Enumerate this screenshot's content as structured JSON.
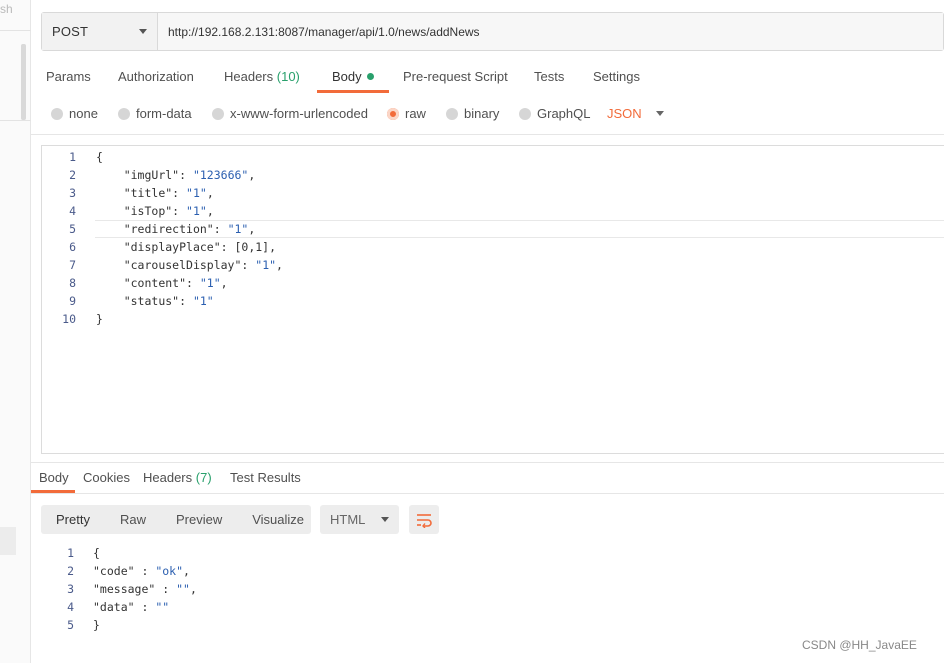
{
  "sidebar": {
    "cut_text": "sh"
  },
  "request": {
    "method": "POST",
    "url": "http://192.168.2.131:8087/manager/api/1.0/news/addNews"
  },
  "req_tabs": {
    "params": "Params",
    "authorization": "Authorization",
    "headers": "Headers",
    "headers_count": "(10)",
    "body": "Body",
    "prerequest": "Pre-request Script",
    "tests": "Tests",
    "settings": "Settings"
  },
  "body_options": {
    "none": "none",
    "form_data": "form-data",
    "urlencoded": "x-www-form-urlencoded",
    "raw": "raw",
    "binary": "binary",
    "graphql": "GraphQL",
    "selected_type": "JSON"
  },
  "request_body": [
    {
      "ln": "1",
      "text": "{"
    },
    {
      "ln": "2",
      "text": "    \"imgUrl\": \"123666\","
    },
    {
      "ln": "3",
      "text": "    \"title\": \"1\","
    },
    {
      "ln": "4",
      "text": "    \"isTop\": \"1\","
    },
    {
      "ln": "5",
      "text": "    \"redirection\": \"1\","
    },
    {
      "ln": "6",
      "text": "    \"displayPlace\": [0,1],"
    },
    {
      "ln": "7",
      "text": "    \"carouselDisplay\": \"1\","
    },
    {
      "ln": "8",
      "text": "    \"content\": \"1\","
    },
    {
      "ln": "9",
      "text": "    \"status\": \"1\""
    },
    {
      "ln": "10",
      "text": "}"
    }
  ],
  "resp_tabs": {
    "body": "Body",
    "cookies": "Cookies",
    "headers": "Headers",
    "headers_count": "(7)",
    "test_results": "Test Results"
  },
  "resp_view": {
    "pretty": "Pretty",
    "raw": "Raw",
    "preview": "Preview",
    "visualize": "Visualize",
    "format": "HTML"
  },
  "response_body": [
    {
      "ln": "1",
      "text": "{"
    },
    {
      "ln": "2",
      "text": "\"code\" : \"ok\","
    },
    {
      "ln": "3",
      "text": "\"message\" : \"\","
    },
    {
      "ln": "4",
      "text": "\"data\" : \"\""
    },
    {
      "ln": "5",
      "text": "}"
    }
  ],
  "watermark": "CSDN @HH_JavaEE",
  "colors": {
    "accent": "#f26b3a",
    "green": "#29a06c"
  }
}
